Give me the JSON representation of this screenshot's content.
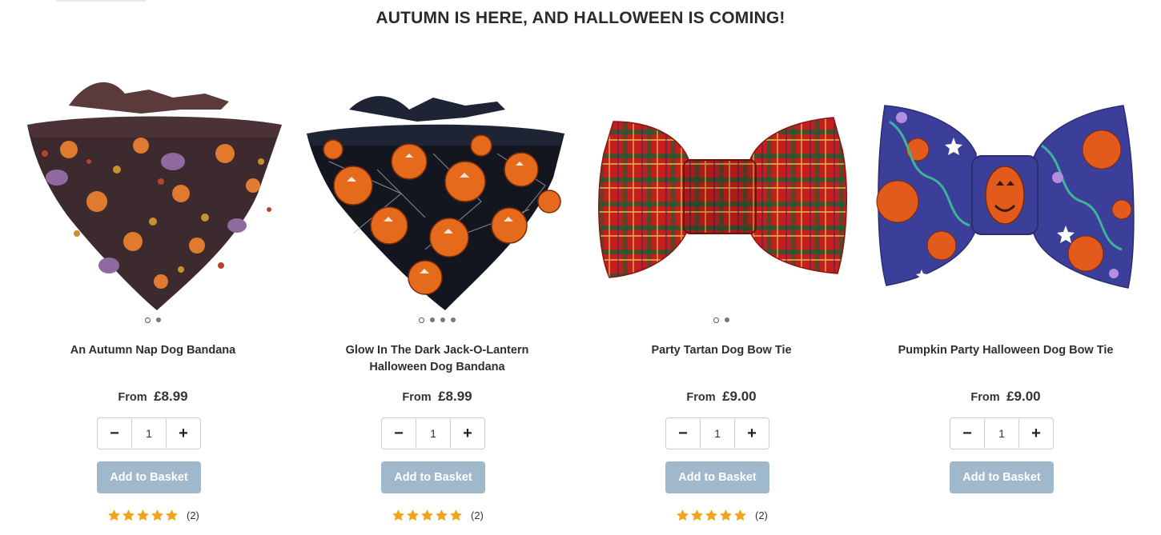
{
  "section": {
    "title": "AUTUMN IS HERE, AND HALLOWEEN IS COMING!"
  },
  "colors": {
    "basket_button": "#9fb8cc",
    "star": "#f2a31b",
    "text": "#333333"
  },
  "products": [
    {
      "name": "An Autumn Nap Dog Bandana",
      "price_from": "From",
      "price": "£8.99",
      "quantity": "1",
      "add_label": "Add to Basket",
      "rating_stars": 5,
      "rating_count": "(2)",
      "image_dots": 2,
      "image_kind": "bandana-autumn"
    },
    {
      "name": "Glow In The Dark Jack-O-Lantern Halloween Dog Bandana",
      "price_from": "From",
      "price": "£8.99",
      "quantity": "1",
      "add_label": "Add to Basket",
      "rating_stars": 5,
      "rating_count": "(2)",
      "image_dots": 4,
      "image_kind": "bandana-jackolantern"
    },
    {
      "name": "Party Tartan Dog Bow Tie",
      "price_from": "From",
      "price": "£9.00",
      "quantity": "1",
      "add_label": "Add to Basket",
      "rating_stars": 5,
      "rating_count": "(2)",
      "image_dots": 2,
      "image_kind": "bowtie-tartan"
    },
    {
      "name": "Pumpkin Party Halloween Dog Bow Tie",
      "price_from": "From",
      "price": "£9.00",
      "quantity": "1",
      "add_label": "Add to Basket",
      "rating_stars": 0,
      "rating_count": "",
      "image_dots": 0,
      "image_kind": "bowtie-pumpkin"
    }
  ],
  "icons": {
    "minus": "minus-icon",
    "plus": "plus-icon",
    "star": "star-icon"
  }
}
